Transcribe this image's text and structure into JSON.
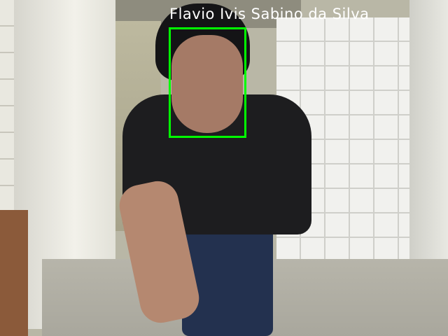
{
  "detection": {
    "name": "Flavio Ivis Sabino da Silva",
    "box_color": "#00ff00",
    "label_color": "#ffffff"
  }
}
